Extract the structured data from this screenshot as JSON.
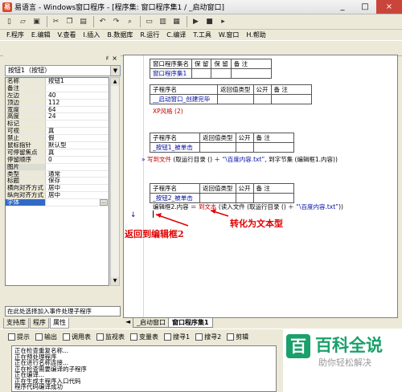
{
  "window": {
    "title": "易语言 - Windows窗口程序 - [程序集: 窗口程序集1 / _启动窗口]",
    "app_icon": "易",
    "min": "_",
    "max": "□",
    "close": "×"
  },
  "menu": [
    "F.程序",
    "E.编辑",
    "V.查看",
    "I.插入",
    "B.数据库",
    "R.运行",
    "C.编译",
    "T.工具",
    "W.窗口",
    "H.帮助"
  ],
  "left_panel": {
    "pin": "♯",
    "close": "×",
    "combo_value": "按钮1（按钮）",
    "properties": [
      {
        "name": "名称",
        "value": "按钮1",
        "sel": false,
        "grp": false
      },
      {
        "name": "备注",
        "value": "",
        "sel": false,
        "grp": false
      },
      {
        "name": "左边",
        "value": "40",
        "sel": false,
        "grp": false
      },
      {
        "name": "顶边",
        "value": "112",
        "sel": false,
        "grp": false
      },
      {
        "name": "宽度",
        "value": "64",
        "sel": false,
        "grp": false
      },
      {
        "name": "高度",
        "value": "24",
        "sel": false,
        "grp": false
      },
      {
        "name": "标记",
        "value": "",
        "sel": false,
        "grp": false
      },
      {
        "name": "可视",
        "value": "真",
        "sel": false,
        "grp": false
      },
      {
        "name": "禁止",
        "value": "假",
        "sel": false,
        "grp": false
      },
      {
        "name": "鼠标指针",
        "value": "默认型",
        "sel": false,
        "grp": false
      },
      {
        "name": "可停留焦点",
        "value": "真",
        "sel": false,
        "grp": false
      },
      {
        "name": "停留顺序",
        "value": "0",
        "sel": false,
        "grp": false
      },
      {
        "name": "图片",
        "value": "",
        "sel": false,
        "grp": true
      },
      {
        "name": "类型",
        "value": "通常",
        "sel": false,
        "grp": false
      },
      {
        "name": "标题",
        "value": "保存",
        "sel": false,
        "grp": false
      },
      {
        "name": "横向对齐方式",
        "value": "居中",
        "sel": false,
        "grp": false
      },
      {
        "name": "纵向对齐方式",
        "value": "居中",
        "sel": false,
        "grp": false
      },
      {
        "name": "字体",
        "value": "",
        "sel": true,
        "grp": false
      }
    ],
    "font_btn": "...",
    "description": "在此处选择加入事件处理子程序",
    "tabs": [
      "支持库",
      "程序",
      "属性"
    ]
  },
  "editor": {
    "assembly_table": {
      "headers": [
        "窗口程序集名",
        "保 留",
        "保 留",
        "备 注"
      ],
      "row": [
        "窗口程序集1",
        "",
        "",
        ""
      ]
    },
    "sub1_table": {
      "headers": [
        "子程序名",
        "返回值类型",
        "公开",
        "备 注"
      ],
      "row": [
        "__启动窗口_创建完毕",
        "",
        "",
        ""
      ]
    },
    "xp_style": "XP风格 (2)",
    "sub2_table": {
      "headers": [
        "子程序名",
        "返回值类型",
        "公开",
        "备 注"
      ],
      "row": [
        "_按钮1_被单击",
        "",
        "",
        ""
      ]
    },
    "line1": {
      "arrow": "»",
      "func": "写到文件",
      "p1": " (取运行目录 () ＋ ",
      "str": "“\\百度内容.txt”",
      "p2": ", 到字节集 (编辑框1.内容))"
    },
    "sub3_table": {
      "headers": [
        "子程序名",
        "返回值类型",
        "公开",
        "备 注"
      ],
      "row": [
        "_按钮2_被单击",
        "",
        "",
        ""
      ]
    },
    "line2": {
      "lhs": "编辑框2.内容 ＝ ",
      "func": "到文本",
      "p1": " (读入文件 (取运行目录 () ＋ ",
      "str": "“\\百度内容.txt”",
      "p2": "))"
    },
    "cursor_mark": "↓",
    "annotations": [
      "返回到编辑框2",
      "转化为文本型"
    ],
    "tabs": [
      "_启动窗口",
      "窗口程序集1"
    ],
    "scroll_arrow": "◄"
  },
  "bottom_tabs": [
    "提示",
    "输出",
    "调用表",
    "监视表",
    "变量表",
    "搜寻1",
    "搜寻2",
    "剪辑"
  ],
  "output_lines": [
    "正在检查重复名称...",
    "正在预处理程序",
    "正在进行名称连接...",
    "正在检查需要编译的子程序",
    "正在编译...",
    "正在生成主程序入口代码",
    "程序代码编译成功"
  ],
  "watermark": {
    "mark": "百",
    "title": "百科全说",
    "subtitle": "助你轻松解决"
  },
  "toolbar_icons": [
    "new-icon",
    "open-icon",
    "save-icon",
    "cut-icon",
    "copy-icon",
    "paste-icon",
    "undo-icon",
    "redo-icon",
    "find-icon",
    "layout1-icon",
    "layout2-icon",
    "layout3-icon",
    "run-icon",
    "stop-icon",
    "step-icon"
  ]
}
